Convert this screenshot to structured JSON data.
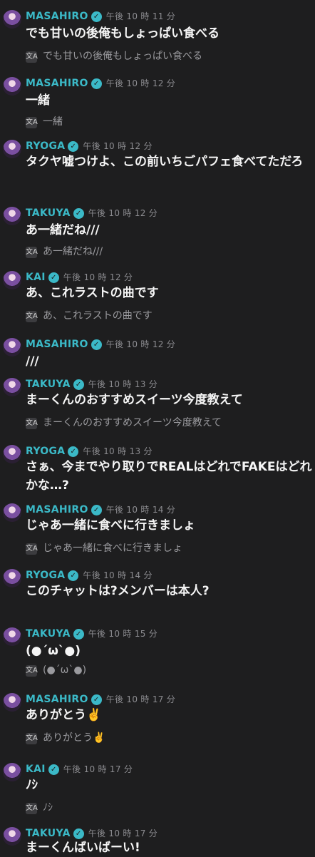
{
  "colors": {
    "background": "#1e1e1f",
    "name": "#3bb9c7",
    "time": "#8c8c90",
    "translation": "#9a9a9e"
  },
  "icons": {
    "verified": "verified-badge-icon",
    "translate": "translate-icon"
  },
  "messages": [
    {
      "name": "MASAHIRO",
      "time": "午後 10 時 11 分",
      "text": "でも甘いの後俺もしょっぱい食べる",
      "translation": "でも甘いの後俺もしょっぱい食べる"
    },
    {
      "name": "MASAHIRO",
      "time": "午後 10 時 12 分",
      "text": "一緒",
      "translation": "一緒"
    },
    {
      "name": "RYOGA",
      "time": "午後 10 時 12 分",
      "text": "タクヤ嘘つけよ、この前いちごパフェ食べてただろ",
      "translation": ""
    },
    {
      "name": "TAKUYA",
      "time": "午後 10 時 12 分",
      "text": "あ一緒だね///",
      "translation": "あ一緒だね///"
    },
    {
      "name": "KAI",
      "time": "午後 10 時 12 分",
      "text": "あ、これラストの曲です",
      "translation": "あ、これラストの曲です"
    },
    {
      "name": "MASAHIRO",
      "time": "午後 10 時 12 分",
      "text": "///",
      "translation": ""
    },
    {
      "name": "TAKUYA",
      "time": "午後 10 時 13 分",
      "text": "まーくんのおすすめスイーツ今度教えて",
      "translation": "まーくんのおすすめスイーツ今度教えて"
    },
    {
      "name": "RYOGA",
      "time": "午後 10 時 13 分",
      "text": "さぁ、今までやり取りでREALはどれでFAKEはどれかな…?",
      "translation": ""
    },
    {
      "name": "MASAHIRO",
      "time": "午後 10 時 14 分",
      "text": "じゃあ一緒に食べに行きましょ",
      "translation": "じゃあ一緒に食べに行きましょ"
    },
    {
      "name": "RYOGA",
      "time": "午後 10 時 14 分",
      "text": "このチャットは?メンバーは本人?",
      "translation": ""
    },
    {
      "name": "TAKUYA",
      "time": "午後 10 時 15 分",
      "text": "(●´ω`●)",
      "translation": "(●´ω`●)"
    },
    {
      "name": "MASAHIRO",
      "time": "午後 10 時 17 分",
      "text": "ありがとう✌️",
      "translation": "ありがとう✌️"
    },
    {
      "name": "KAI",
      "time": "午後 10 時 17 分",
      "text": "ﾉｼ",
      "translation": "ﾉｼ"
    },
    {
      "name": "TAKUYA",
      "time": "午後 10 時 17 分",
      "text": "まーくんばいばーい!",
      "translation": ""
    }
  ]
}
